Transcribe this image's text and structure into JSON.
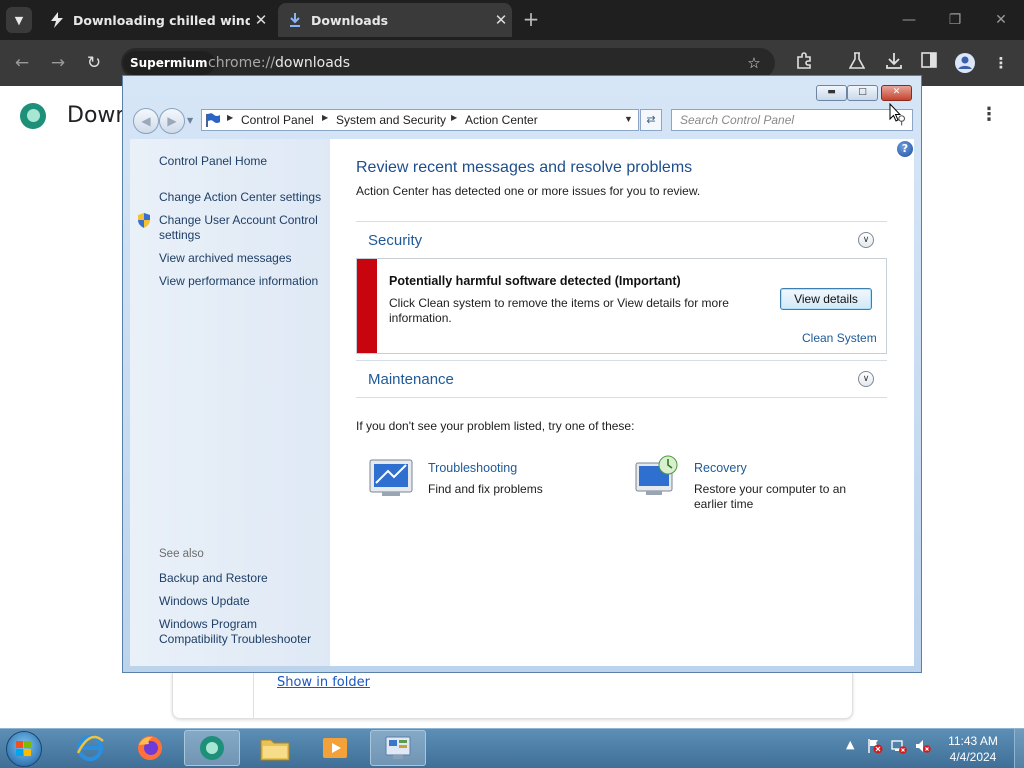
{
  "browser": {
    "tabs": [
      {
        "title": "Downloading chilled windows",
        "active": false
      },
      {
        "title": "Downloads",
        "active": true
      }
    ],
    "new_tab_label": "+",
    "omnibox": {
      "chip": "Supermium",
      "url_scheme": "chrome://",
      "url_path": "downloads"
    }
  },
  "downloads_page": {
    "title": "Downl",
    "show_in_folder": "Show in folder"
  },
  "control_panel": {
    "breadcrumb": [
      "Control Panel",
      "System and Security",
      "Action Center"
    ],
    "search_placeholder": "Search Control Panel",
    "left_links": [
      "Control Panel Home",
      "Change Action Center settings",
      "Change User Account Control settings",
      "View archived messages",
      "View performance information"
    ],
    "see_also_label": "See also",
    "see_also": [
      "Backup and Restore",
      "Windows Update",
      "Windows Program Compatibility Troubleshooter"
    ],
    "heading": "Review recent messages and resolve problems",
    "subheading": "Action Center has detected one or more issues for you to review.",
    "security": {
      "title": "Security",
      "alert_title": "Potentially harmful software detected  (Important)",
      "alert_body": "Click Clean system to remove the items or View details for more information.",
      "view_details": "View details",
      "clean_system": "Clean System"
    },
    "maintenance_title": "Maintenance",
    "try_text": "If you don't see your problem listed, try one of these:",
    "tools": [
      {
        "name": "Troubleshooting",
        "desc": "Find and fix problems"
      },
      {
        "name": "Recovery",
        "desc": "Restore your computer to an earlier time"
      }
    ]
  },
  "taskbar": {
    "time": "11:43 AM",
    "date": "4/4/2024"
  },
  "colors": {
    "alert_red": "#c8050e",
    "link_blue": "#1e5a98",
    "taskbar": "#4a7ba3"
  }
}
